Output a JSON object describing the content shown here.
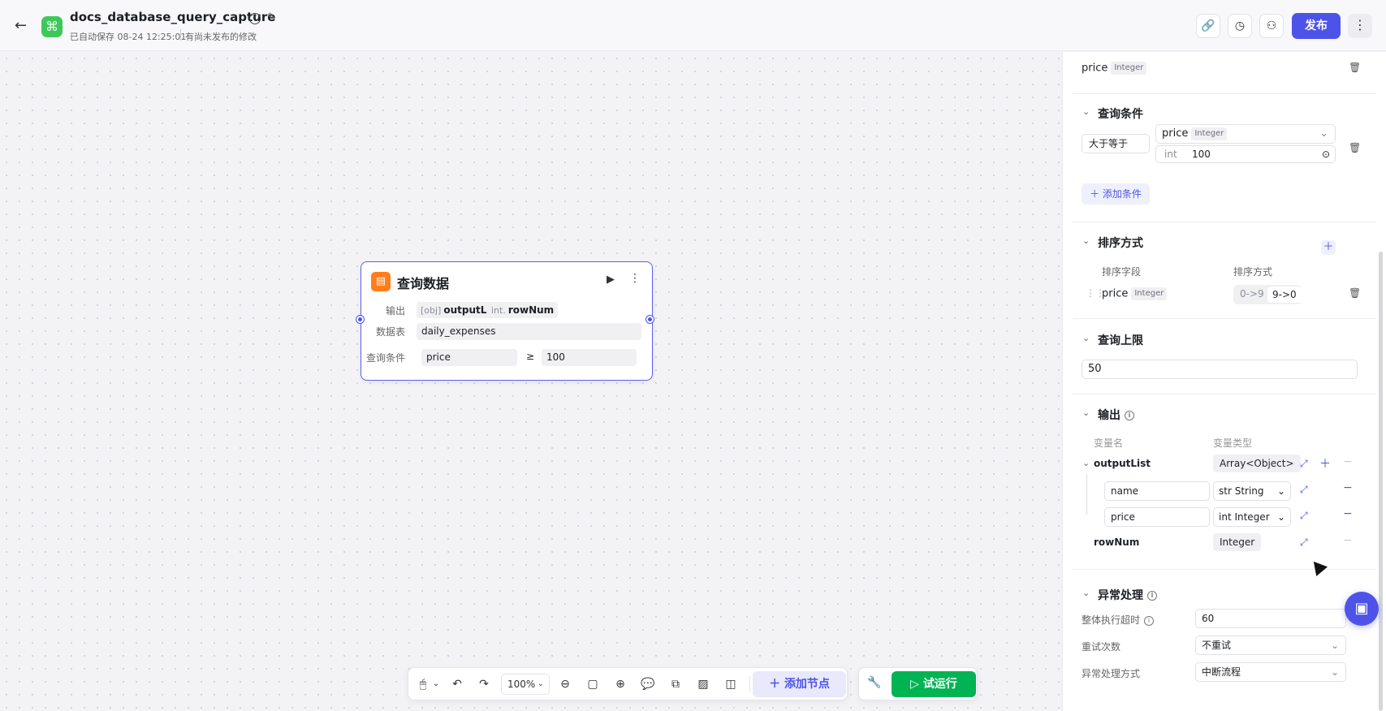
{
  "header": {
    "back_icon": "←",
    "logo_icon": "⌘",
    "title": "docs_database_query_capture",
    "autosave": "已自动保存 08-24 12:25:01",
    "unpublished": "有尚未发布的修改",
    "publish": "发布",
    "icons": [
      "link-icon",
      "history-icon",
      "user-icon",
      "more-icon"
    ]
  },
  "node": {
    "title": "查询数据",
    "output_label": "输出",
    "outputs": [
      {
        "prefix": "[obj]",
        "name": "outputList"
      },
      {
        "prefix": "int.",
        "name": "rowNum"
      }
    ],
    "table_label": "数据表",
    "table": "daily_expenses",
    "cond_label": "查询条件",
    "cond_field": "price",
    "cond_op": "≥",
    "cond_value": "100"
  },
  "toolbar": {
    "zoom": "100%",
    "add_node": "添加节点",
    "try_run": "试运行"
  },
  "panel": {
    "top_field": {
      "name": "price",
      "type": "Integer"
    },
    "query_cond": {
      "title": "查询条件",
      "operator": "大于等于",
      "field": "price",
      "field_type": "Integer",
      "value_type": "int",
      "value": "100",
      "add_label": "添加条件"
    },
    "sort": {
      "title": "排序方式",
      "col_field": "排序字段",
      "col_order": "排序方式",
      "field": "price",
      "field_type": "Integer",
      "asc": "0->9",
      "desc": "9->0"
    },
    "limit": {
      "title": "查询上限",
      "value": "50"
    },
    "output": {
      "title": "输出",
      "col_name": "变量名",
      "col_type": "变量类型",
      "list_name": "outputList",
      "list_type": "Array<Object>",
      "children": [
        {
          "name": "name",
          "type": "str String"
        },
        {
          "name": "price",
          "type": "int Integer"
        }
      ],
      "row_name": "rowNum",
      "row_type": "Integer"
    },
    "error": {
      "title": "异常处理",
      "timeout_label": "整体执行超时",
      "timeout_value": "60",
      "retry_label": "重试次数",
      "retry_value": "不重试",
      "mode_label": "异常处理方式",
      "mode_value": "中断流程"
    }
  },
  "colors": {
    "accent": "#4d53e8",
    "run": "#00b453",
    "node_icon": "#ff7d1a",
    "logo": "#3ec85a"
  }
}
